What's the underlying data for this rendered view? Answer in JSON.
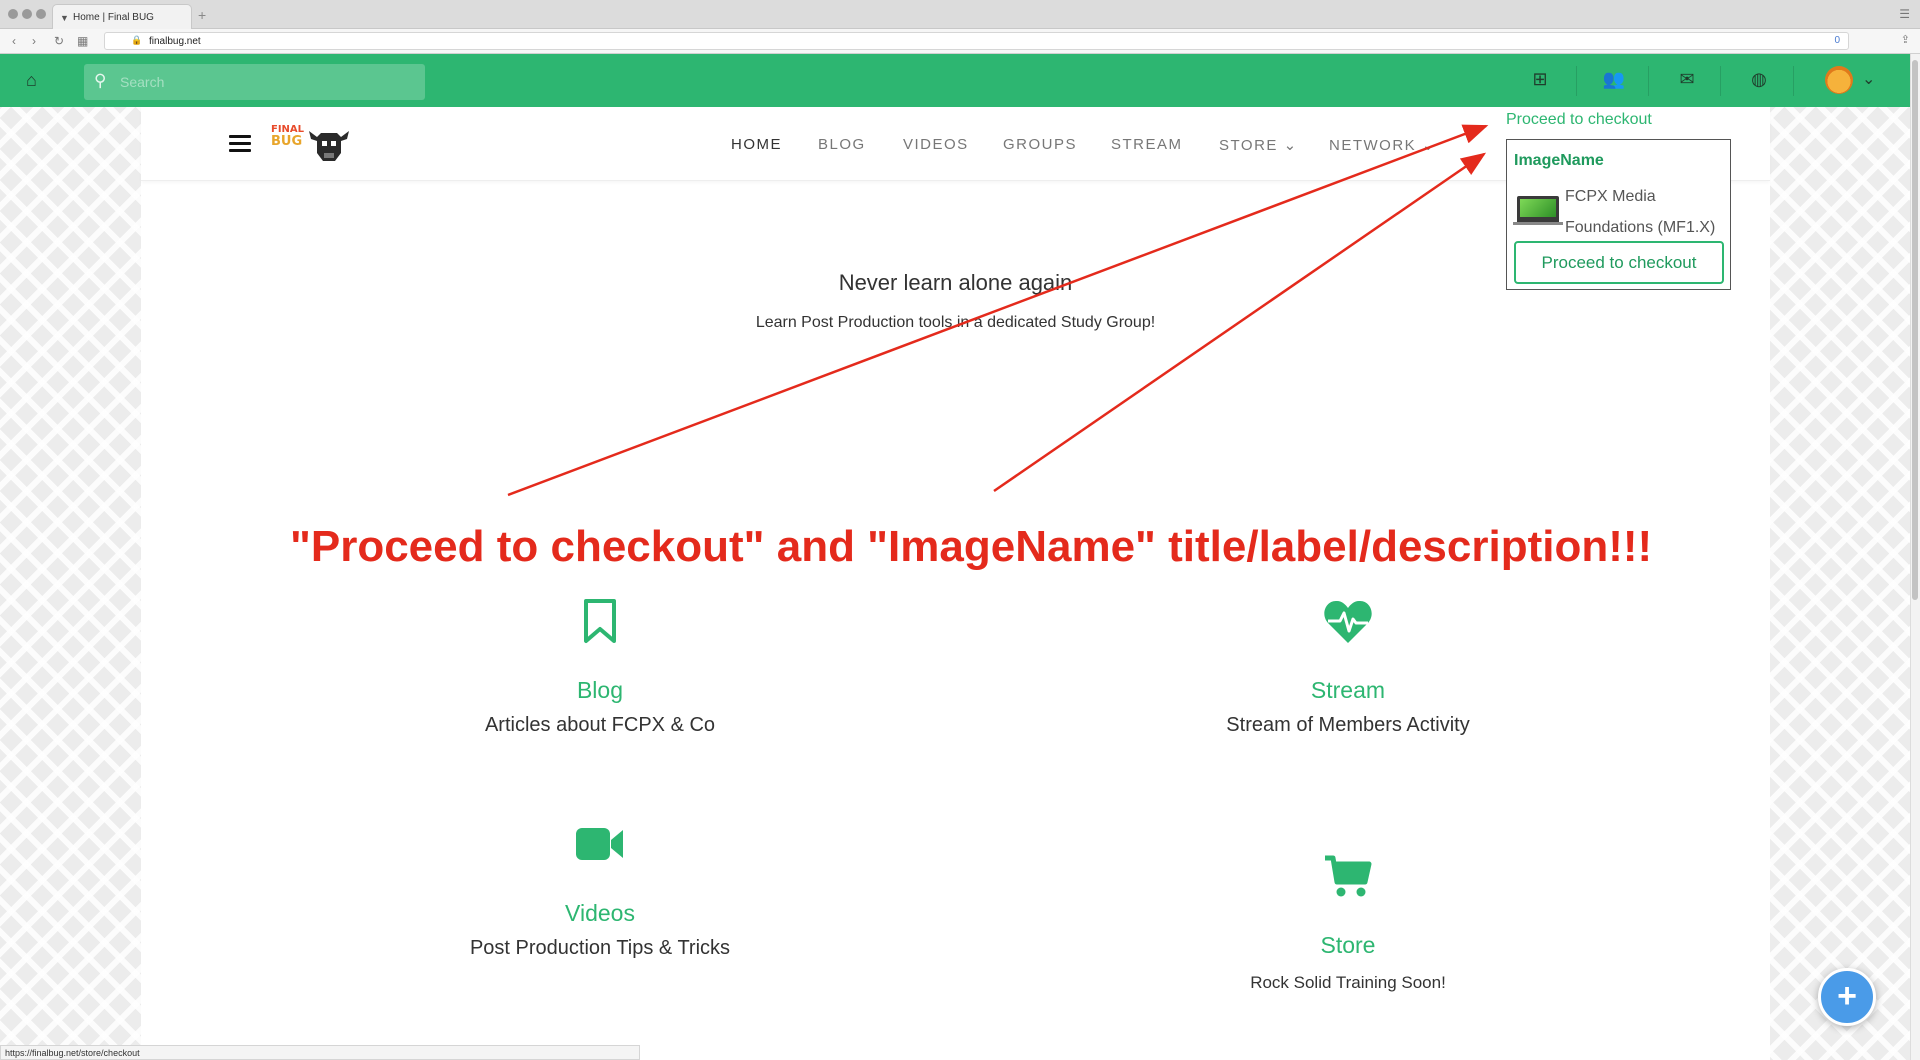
{
  "browser": {
    "tab_title": "Home | Final BUG",
    "url": "finalbug.net",
    "status_url": "https://finalbug.net/store/checkout",
    "extension_badge": "0"
  },
  "header": {
    "search_placeholder": "Search",
    "accent_color": "#2db671"
  },
  "site_nav": {
    "logo_line1": "FINAL",
    "logo_line2": "BUG",
    "items": [
      {
        "label": "HOME"
      },
      {
        "label": "BLOG"
      },
      {
        "label": "VIDEOS"
      },
      {
        "label": "GROUPS"
      },
      {
        "label": "STREAM"
      },
      {
        "label": "STORE"
      },
      {
        "label": "NETWORK"
      }
    ]
  },
  "hero": {
    "tagline": "Never learn alone again",
    "subline": "Learn Post Production tools in a dedicated Study Group!"
  },
  "features": [
    {
      "icon": "bookmark-icon",
      "title": "Blog",
      "desc": "Articles about FCPX & Co"
    },
    {
      "icon": "heartbeat-icon",
      "title": "Stream",
      "desc": "Stream of Members Activity"
    },
    {
      "icon": "video-camera-icon",
      "title": "Videos",
      "desc": "Post Production Tips & Tricks"
    },
    {
      "icon": "shopping-cart-icon",
      "title": "Store",
      "desc": "Rock Solid Training Soon!"
    }
  ],
  "cart": {
    "link_label": "Proceed to checkout",
    "item_title": "ImageName",
    "item_name": "FCPX Media Foundations (MF1.X)",
    "button_label": "Proceed to checkout"
  },
  "annotation": {
    "text": "\"Proceed to checkout\" and \"ImageName\" title/label/description!!!",
    "color": "#e42a1c"
  }
}
